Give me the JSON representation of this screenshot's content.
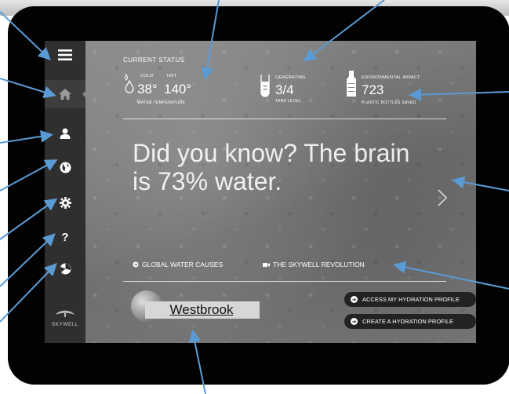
{
  "sidebar": {
    "items": [
      {
        "icon": "menu-icon"
      },
      {
        "icon": "home-icon"
      },
      {
        "icon": "user-icon"
      },
      {
        "icon": "globe-icon"
      },
      {
        "icon": "gear-icon"
      },
      {
        "icon": "question-icon"
      },
      {
        "icon": "pie-icon"
      }
    ],
    "brand": "SKYWELL"
  },
  "status": {
    "title": "CURRENT STATUS",
    "cold_label": "COLD",
    "cold_value": "38°",
    "hot_label": "HOT",
    "hot_value": "140°",
    "water_temp_label": "WATER TEMPERATURE",
    "generating_label": "GENERATING",
    "tank_value": "3/4",
    "tank_label": "TANK LEVEL",
    "impact_label": "ENVIRONMENTAL IMPACT",
    "bottles_value": "723",
    "bottles_label": "PLASTIC BOTTLES SAVED"
  },
  "main": {
    "headline": "Did you know? The brain is 73% water.",
    "link_causes": "GLOBAL WATER CAUSES",
    "link_revolution": "THE SKYWELL REVOLUTION",
    "location": "Westbrook",
    "btn_access": "ACCESS MY HYDRATION PROFILE",
    "btn_create": "CREATE A HYDRATION PROFILE"
  },
  "colors": {
    "annotation": "#5b9bd5",
    "sidebar": "#2f2f2f"
  }
}
